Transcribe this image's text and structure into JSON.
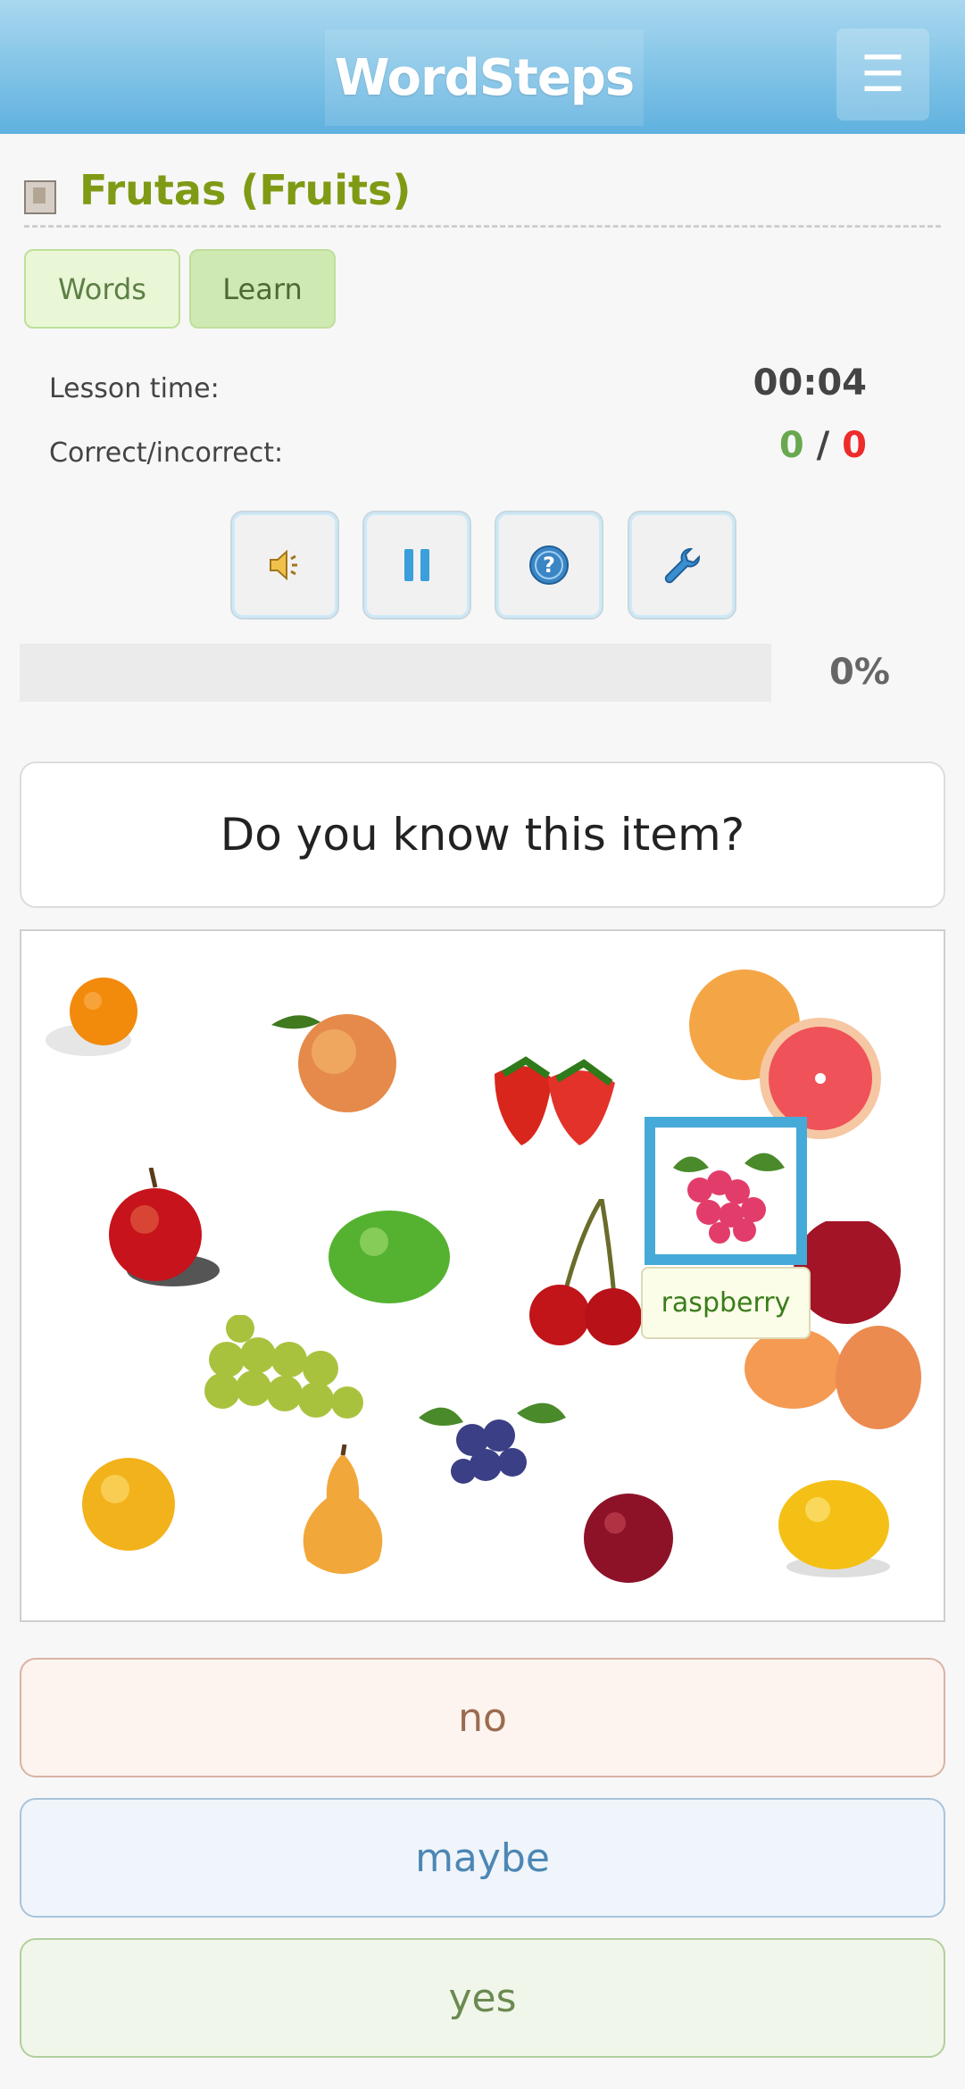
{
  "header": {
    "logo_text": "WordSteps",
    "menu_icon": "hamburger-menu-icon"
  },
  "lesson": {
    "title": "Frutas (Fruits)",
    "tabs": [
      {
        "label": "Words"
      },
      {
        "label": "Learn"
      }
    ],
    "stats": {
      "time_label": "Lesson time:",
      "time_value": "00:04",
      "ci_label": "Correct/incorrect:",
      "correct": "0",
      "separator": "/",
      "incorrect": "0"
    },
    "controls": [
      "speaker-icon",
      "pause-icon",
      "help-icon",
      "wrench-icon"
    ],
    "progress": {
      "percent": 0,
      "label": "0%"
    }
  },
  "question": {
    "text": "Do you know this item?"
  },
  "picture": {
    "highlighted_item": "raspberry",
    "tooltip": "raspberry",
    "fruits": [
      "orange",
      "peach",
      "strawberry",
      "grapefruit",
      "apple",
      "lime",
      "cherry",
      "nectarine",
      "grapes",
      "blueberry",
      "apricot",
      "pear",
      "plum",
      "lemon"
    ]
  },
  "answers": {
    "no": "no",
    "maybe": "maybe",
    "yes": "yes"
  },
  "colors": {
    "accent": "#45aad8",
    "title": "#7f9a14",
    "correct": "#6aa84f",
    "incorrect": "#ee2b2b"
  }
}
